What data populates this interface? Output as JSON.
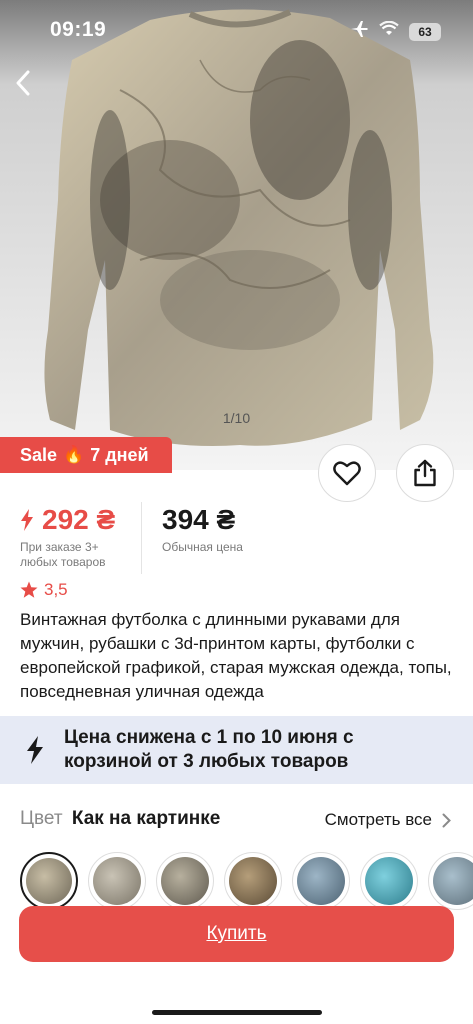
{
  "status": {
    "time": "09:19",
    "battery": "63"
  },
  "gallery": {
    "counter": "1/10"
  },
  "sale": {
    "label": "Sale",
    "emoji": "🔥",
    "days": "7 дней"
  },
  "price": {
    "promo": "292 ₴",
    "promo_note": "При заказе 3+ любых товаров",
    "regular": "394 ₴",
    "regular_note": "Обычная цена"
  },
  "rating": "3,5",
  "product_title": "Винтажная футболка с длинными рукавами для мужчин, рубашки с 3d-принтом карты, футболки с европейской графикой, старая мужская одежда, топы, повседневная уличная одежда",
  "promo_banner": "Цена снижена с 1 по 10 июня с корзиной от 3 любых товаров",
  "color": {
    "label": "Цвет",
    "value": "Как на картинке",
    "see_all": "Смотреть все"
  },
  "buy_label": "Купить",
  "colors": {
    "accent": "#e74c47",
    "banner": "#e6eaf5"
  }
}
